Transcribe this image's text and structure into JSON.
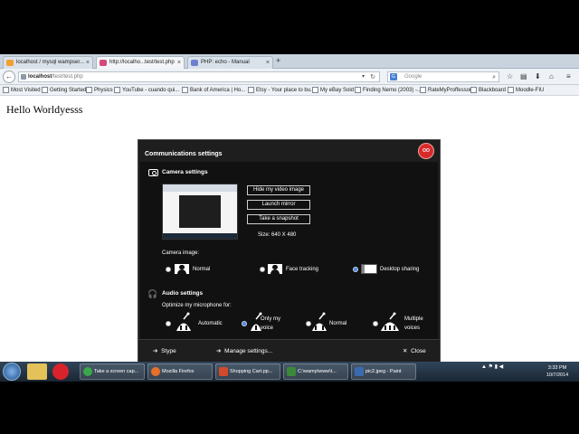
{
  "browser": {
    "tabs": [
      {
        "label": "localhost / mysql wampser...",
        "color": "#f29f2f"
      },
      {
        "label": "http://localho...test/test.php",
        "color": "#d4477f"
      },
      {
        "label": "PHP: echo - Manual",
        "color": "#6f7fd1"
      }
    ],
    "new_tab": "+",
    "url_prefix": "localhost",
    "url_path": "/test/test.php",
    "search_placeholder": "Google",
    "search_engine": "G",
    "bookmarks": [
      "Most Visited",
      "Getting Started",
      "Physics",
      "YouTube - cuando qui...",
      "Bank of America | Ho...",
      "Etsy - Your place to bu...",
      "My eBay Sold",
      "Finding Nemo (2003) -...",
      "RateMyProffessor",
      "Blackboard",
      "Moodle-FIU"
    ]
  },
  "page": {
    "hello_text": "Hello Worldyesss"
  },
  "dialog": {
    "title": "Communications settings",
    "logo_text": "OO",
    "camera": {
      "title": "Camera settings",
      "buttons": {
        "hide": "Hide my video image",
        "mirror": "Launch mirror",
        "snapshot": "Take a snapshot"
      },
      "size": "Size: 640 X 480",
      "image_label": "Camera image:",
      "options": [
        {
          "label": "Normal",
          "selected": false
        },
        {
          "label": "Face tracking",
          "selected": false
        },
        {
          "label": "Desktop sharing",
          "selected": true
        }
      ]
    },
    "audio": {
      "title": "Audio settings",
      "optimize_label": "Optimize my microphone for:",
      "options": [
        {
          "label": "Automatic",
          "selected": false
        },
        {
          "label": "Only my\nvoice",
          "line1": "Only my",
          "line2": "voice",
          "selected": true
        },
        {
          "label": "Normal",
          "selected": false
        },
        {
          "label": "Multiple\nvoices",
          "line1": "Multiple",
          "line2": "voices",
          "selected": false
        }
      ]
    },
    "footer": {
      "stype": "Stype",
      "manage": "Manage settings...",
      "close": "Close"
    }
  },
  "taskbar": {
    "items": [
      {
        "label": "Take a screen cap...",
        "color": "#3aa84a"
      },
      {
        "label": "Mozilla Firefox",
        "color": "#e8702a"
      },
      {
        "label": "Shopping Cart.pp...",
        "color": "#d24a2a"
      },
      {
        "label": "C:\\wamp\\www\\t...",
        "color": "#3a8a3a"
      },
      {
        "label": "pic2.jpeg - Paint",
        "color": "#3a6ab0"
      }
    ],
    "clock_time": "3:33 PM",
    "clock_date": "10/7/2014"
  },
  "colors": {
    "dialog_bg": "#1e1e1e",
    "selected_radio": "#4f87d9",
    "logo_red": "#d82a2a"
  }
}
